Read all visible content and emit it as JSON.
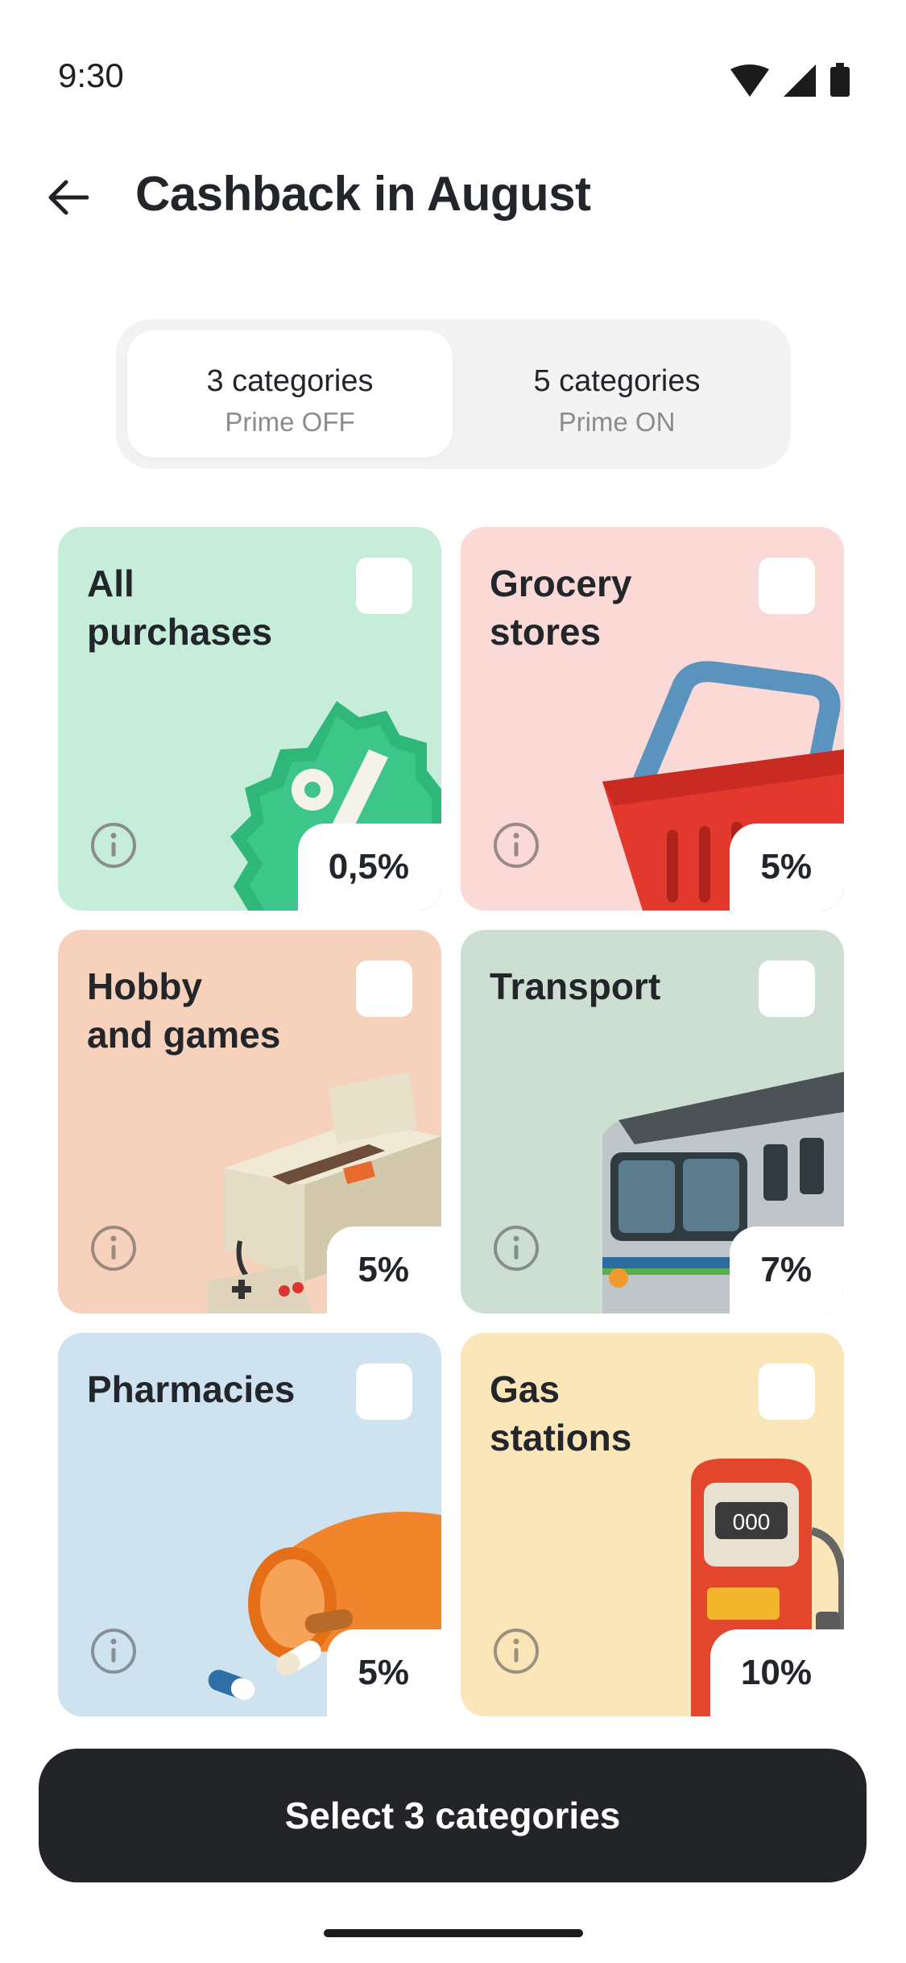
{
  "status_bar": {
    "time": "9:30"
  },
  "header": {
    "title": "Cashback in August"
  },
  "segment": {
    "options": [
      {
        "title": "3 categories",
        "subtitle": "Prime OFF",
        "selected": true
      },
      {
        "title": "5 categories",
        "subtitle": "Prime ON",
        "selected": false
      }
    ]
  },
  "categories": [
    {
      "title": "All\npurchases",
      "percent": "0,5%",
      "bg": "#c6ecda",
      "icon": "percent-badge-icon",
      "checked": false
    },
    {
      "title": "Grocery\nstores",
      "percent": "5%",
      "bg": "#fbd9d6",
      "icon": "shopping-basket-icon",
      "checked": false
    },
    {
      "title": "Hobby\nand games",
      "percent": "5%",
      "bg": "#f6d2bd",
      "icon": "game-console-icon",
      "checked": false
    },
    {
      "title": "Transport",
      "percent": "7%",
      "bg": "#cddfd2",
      "icon": "train-icon",
      "checked": false
    },
    {
      "title": "Pharmacies",
      "percent": "5%",
      "bg": "#cfe2f0",
      "icon": "pill-bottle-icon",
      "checked": false
    },
    {
      "title": "Gas\nstations",
      "percent": "10%",
      "bg": "#fae6b8",
      "icon": "gas-pump-icon",
      "checked": false
    }
  ],
  "footer": {
    "cta_label": "Select 3 categories"
  },
  "colors": {
    "cta_bg": "#222428",
    "segment_bg": "#f3f3f4"
  }
}
